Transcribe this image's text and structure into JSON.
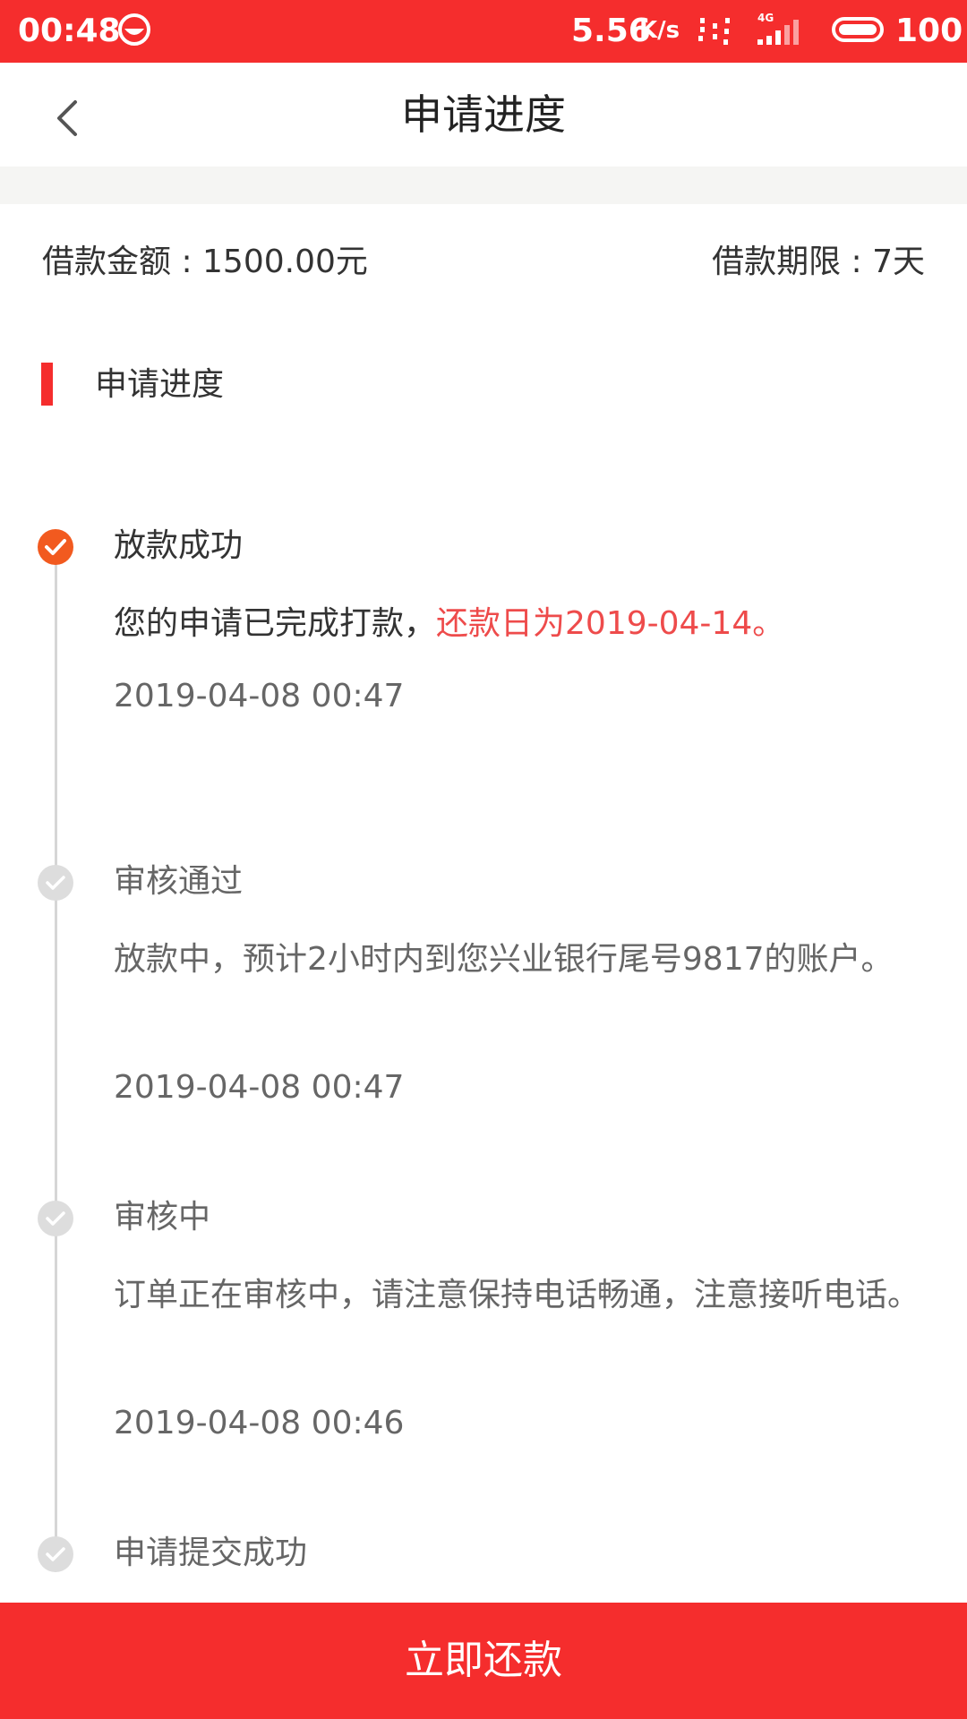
{
  "status_bar": {
    "time": "00:48",
    "network_speed": "5.56",
    "network_speed_unit": "K/s",
    "network_type": "4G",
    "battery_level": "100",
    "icons": [
      "app-notification-icon",
      "data-transfer-icon",
      "signal-icon",
      "battery-icon"
    ]
  },
  "header": {
    "title": "申请进度",
    "back_icon": "chevron-left-icon"
  },
  "loan_summary": {
    "amount": "借款金额 : 1500.00元",
    "term": "借款期限 : 7天"
  },
  "section": {
    "title": "申请进度"
  },
  "timeline": {
    "steps": [
      {
        "title": "放款成功",
        "description": "您的申请已完成打款，",
        "description_highlight": "还款日为2019-04-14。",
        "time": "2019-04-08 00:47",
        "status": "completed"
      },
      {
        "title": "审核通过",
        "description": "放款中，预计2小时内到您兴业银行尾号9817的账户。",
        "time": "2019-04-08 00:47",
        "status": "inactive"
      },
      {
        "title": "审核中",
        "description": "订单正在审核中，请注意保持电话畅通，注意接听电话。",
        "time": "2019-04-08 00:46",
        "status": "inactive"
      },
      {
        "title": "申请提交成功",
        "status": "inactive"
      }
    ]
  },
  "footer": {
    "repay_label": "立即还款"
  },
  "colors": {
    "accent": "#f52d2d",
    "highlight_text": "#ee4b4b",
    "completed_dot": "#f25a1f",
    "inactive_dot": "#dddddd"
  }
}
